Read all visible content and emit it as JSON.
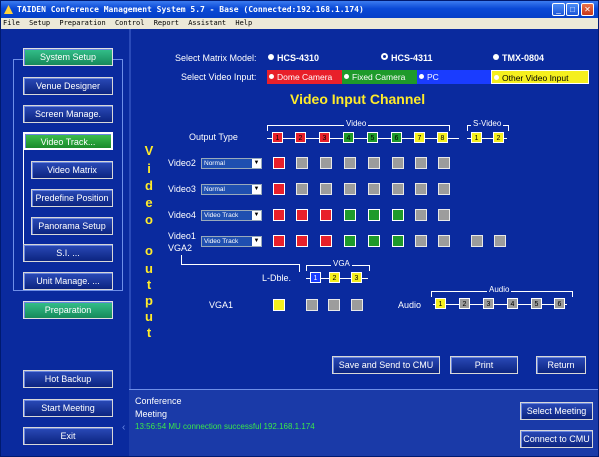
{
  "window": {
    "title": "TAIDEN Conference Management System 5.7 - Base (Connected:192.168.1.174)"
  },
  "menu": [
    "File",
    "Setup",
    "Preparation",
    "Control",
    "Report",
    "Assistant",
    "Help"
  ],
  "sidebar": {
    "system_setup": "System Setup",
    "venue_designer": "Venue Designer",
    "screen_manage": "Screen Manage.",
    "video_track": "Video Track...",
    "video_matrix": "Video Matrix",
    "predefine_position": "Predefine Position",
    "panorama_setup": "Panorama Setup",
    "si": "S.I. ...",
    "unit_manage": "Unit Manage. ...",
    "preparation": "Preparation",
    "hot_backup": "Hot Backup",
    "start_meeting": "Start Meeting",
    "exit": "Exit"
  },
  "matrix_model": {
    "label": "Select Matrix Model:",
    "options": [
      "HCS-4310",
      "HCS-4311",
      "TMX-0804"
    ],
    "selected": "HCS-4311"
  },
  "video_input": {
    "label": "Select Video Input:",
    "options": [
      "Dome Camera",
      "Fixed Camera",
      "PC",
      "Other Video Input"
    ]
  },
  "main_title": "Video Input Channel",
  "vertical_left": [
    "V",
    "i",
    "d",
    "e",
    "o"
  ],
  "vertical_right": [
    "o",
    "u",
    "t",
    "p",
    "u",
    "t"
  ],
  "output_type_label": "Output Type",
  "video_group_label": "Video",
  "video_numbers": [
    "1",
    "2",
    "3",
    "4",
    "5",
    "6",
    "7",
    "8"
  ],
  "svideo_label": "S-Video",
  "svideo_numbers": [
    "1",
    "2"
  ],
  "rows": [
    {
      "label": "Video2",
      "mode": "Normal"
    },
    {
      "label": "Video3",
      "mode": "Normal"
    },
    {
      "label": "Video4",
      "mode": "Video Track"
    },
    {
      "label": "Video1",
      "mode": "Video Track"
    }
  ],
  "vga2_label": "VGA2",
  "ldble_label": "L-Dble.",
  "vga_group_label": "VGA",
  "vga_numbers": [
    "1",
    "2",
    "3"
  ],
  "vga1_label": "VGA1",
  "audio_label": "Audio",
  "audio_group_label": "Audio",
  "audio_numbers": [
    "1",
    "2",
    "3",
    "4",
    "5",
    "6"
  ],
  "buttons": {
    "save_send": "Save and Send to CMU",
    "print": "Print",
    "return": "Return",
    "select_meeting": "Select Meeting",
    "connect_cmu": "Connect to CMU"
  },
  "status": {
    "line1": "Conference",
    "line2": "Meeting",
    "line3": "13:56:54 MU connection successful 192.168.1.174"
  },
  "colors": {
    "background": "#0a2a9e",
    "title_yellow": "#ffeb2a",
    "red": "#e8202a",
    "green": "#1e9a2a",
    "blue": "#1a3cff",
    "yellow": "#f5ef1e",
    "status_green": "#3ae84a"
  }
}
